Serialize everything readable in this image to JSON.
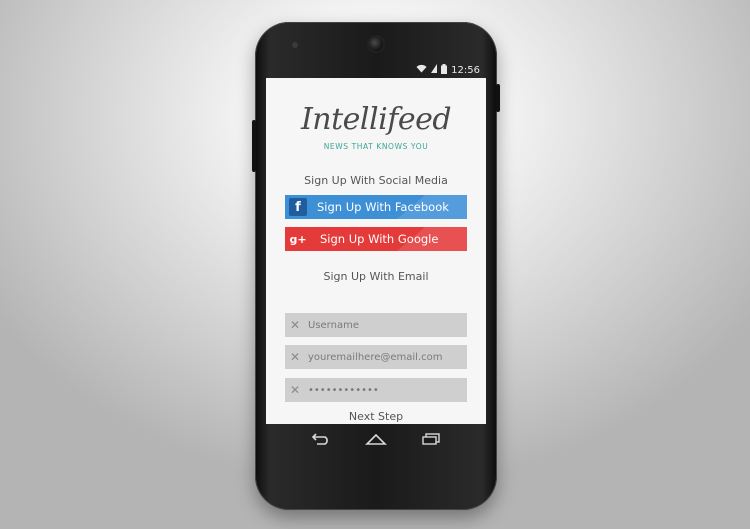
{
  "status": {
    "time": "12:56"
  },
  "app": {
    "logo": "Intellifeed",
    "tagline": "NEWS THAT KNOWS YOU"
  },
  "social": {
    "heading": "Sign Up With Social Media",
    "facebook_label": "Sign Up With Facebook",
    "facebook_icon": "f",
    "google_label": "Sign Up With Google",
    "google_icon": "g+",
    "facebook_color": "#3d8fd6",
    "google_color": "#e53a3a"
  },
  "email": {
    "heading": "Sign Up With Email",
    "username_placeholder": "Username",
    "email_placeholder": "youremailhere@email.com",
    "password_value": "••••••••••••",
    "next_label": "Next Step"
  },
  "icons": {
    "clear": "x-icon",
    "back": "back-icon",
    "home": "home-icon",
    "recents": "recents-icon"
  },
  "colors": {
    "accent": "#3aa59a",
    "field_bg": "#cfcfcf"
  }
}
